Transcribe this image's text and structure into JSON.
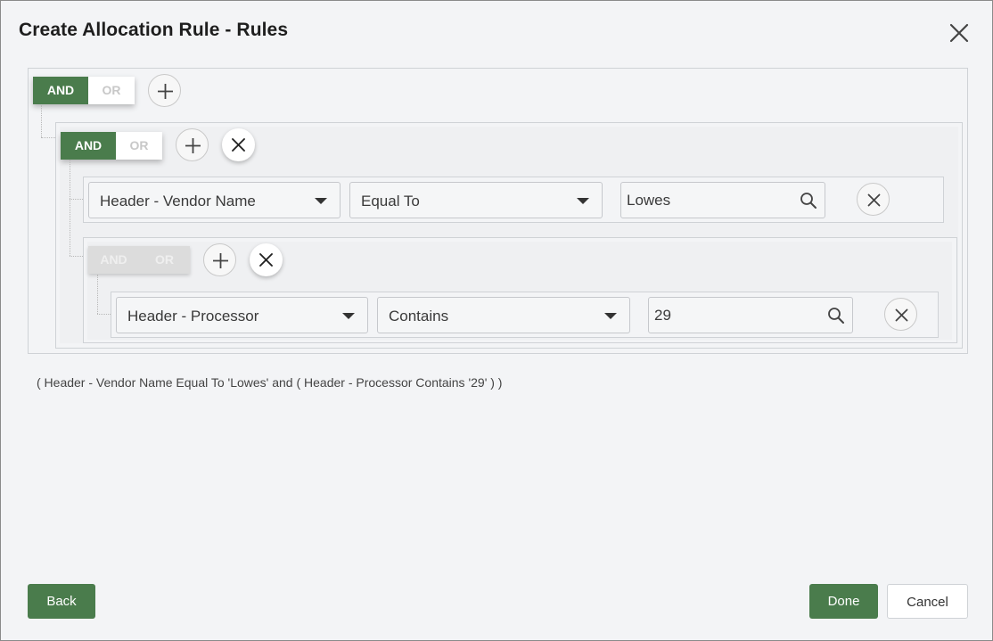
{
  "dialog": {
    "title": "Create Allocation Rule - Rules"
  },
  "groups": [
    {
      "and_label": "AND",
      "or_label": "OR",
      "selected": "AND"
    },
    {
      "and_label": "AND",
      "or_label": "OR",
      "selected": "AND"
    },
    {
      "and_label": "AND",
      "or_label": "OR",
      "selected": "none"
    }
  ],
  "conditions": [
    {
      "field": "Header - Vendor Name",
      "operator": "Equal To",
      "value": "Lowes"
    },
    {
      "field": "Header - Processor",
      "operator": "Contains",
      "value": "29"
    }
  ],
  "summary": "( Header - Vendor Name Equal To 'Lowes' and ( Header - Processor Contains '29' ) )",
  "footer": {
    "back_label": "Back",
    "done_label": "Done",
    "cancel_label": "Cancel"
  },
  "colors": {
    "accent": "#4a7c4c",
    "background": "#f3f4f6"
  },
  "icons": [
    "close-icon",
    "plus-icon",
    "search-icon",
    "remove-circle-icon",
    "caret-down-icon"
  ]
}
